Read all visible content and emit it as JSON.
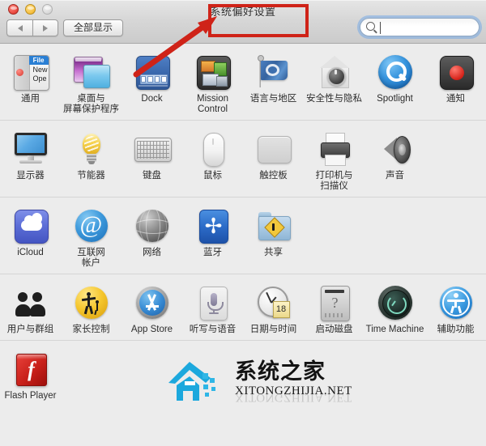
{
  "window": {
    "title": "系统偏好设置",
    "traffic_lights": [
      "close",
      "minimize",
      "zoom"
    ],
    "back_label": "◀",
    "forward_label": "▶",
    "show_all_label": "全部显示"
  },
  "search": {
    "value": "",
    "placeholder": "",
    "icon": "search-icon"
  },
  "colors": {
    "toolbar_top": "#e6e6e6",
    "toolbar_bottom": "#cbcbcb",
    "content_bg": "#ececec",
    "divider": "#d5d5d5",
    "annotation_red": "#cf2318",
    "focus_ring": "#76aae6",
    "label_text": "#2d2d2d"
  },
  "annotation": {
    "box_target": "系统偏好设置",
    "arrow": "red-arrow-pointing-to-title"
  },
  "rows": [
    {
      "id": "personal",
      "items": [
        {
          "label": "通用",
          "icon": "general-icon"
        },
        {
          "label": "桌面与\n屏幕保护程序",
          "icon": "desktop-screensaver-icon"
        },
        {
          "label": "Dock",
          "icon": "dock-icon"
        },
        {
          "label": "Mission\nControl",
          "icon": "mission-control-icon"
        },
        {
          "label": "语言与地区",
          "icon": "language-region-icon"
        },
        {
          "label": "安全性与隐私",
          "icon": "security-privacy-icon"
        },
        {
          "label": "Spotlight",
          "icon": "spotlight-icon"
        },
        {
          "label": "通知",
          "icon": "notifications-icon"
        }
      ]
    },
    {
      "id": "hardware",
      "items": [
        {
          "label": "显示器",
          "icon": "displays-icon"
        },
        {
          "label": "节能器",
          "icon": "energy-saver-icon"
        },
        {
          "label": "键盘",
          "icon": "keyboard-icon"
        },
        {
          "label": "鼠标",
          "icon": "mouse-icon"
        },
        {
          "label": "触控板",
          "icon": "trackpad-icon"
        },
        {
          "label": "打印机与\n扫描仪",
          "icon": "printers-scanners-icon"
        },
        {
          "label": "声音",
          "icon": "sound-icon"
        }
      ]
    },
    {
      "id": "internet-wireless",
      "items": [
        {
          "label": "iCloud",
          "icon": "icloud-icon"
        },
        {
          "label": "互联网\n帐户",
          "icon": "internet-accounts-icon"
        },
        {
          "label": "网络",
          "icon": "network-icon"
        },
        {
          "label": "蓝牙",
          "icon": "bluetooth-icon"
        },
        {
          "label": "共享",
          "icon": "sharing-icon"
        }
      ]
    },
    {
      "id": "system",
      "items": [
        {
          "label": "用户与群组",
          "icon": "users-groups-icon"
        },
        {
          "label": "家长控制",
          "icon": "parental-controls-icon"
        },
        {
          "label": "App Store",
          "icon": "app-store-icon"
        },
        {
          "label": "听写与语音",
          "icon": "dictation-speech-icon"
        },
        {
          "label": "日期与时间",
          "icon": "date-time-icon",
          "badge": "18"
        },
        {
          "label": "启动磁盘",
          "icon": "startup-disk-icon"
        },
        {
          "label": "Time Machine",
          "icon": "time-machine-icon"
        },
        {
          "label": "辅助功能",
          "icon": "accessibility-icon"
        }
      ]
    },
    {
      "id": "other",
      "items": [
        {
          "label": "Flash Player",
          "icon": "flash-player-icon"
        }
      ]
    }
  ],
  "watermark": {
    "cn": "系统之家",
    "en": "XITONGZHIJIA.NET"
  }
}
